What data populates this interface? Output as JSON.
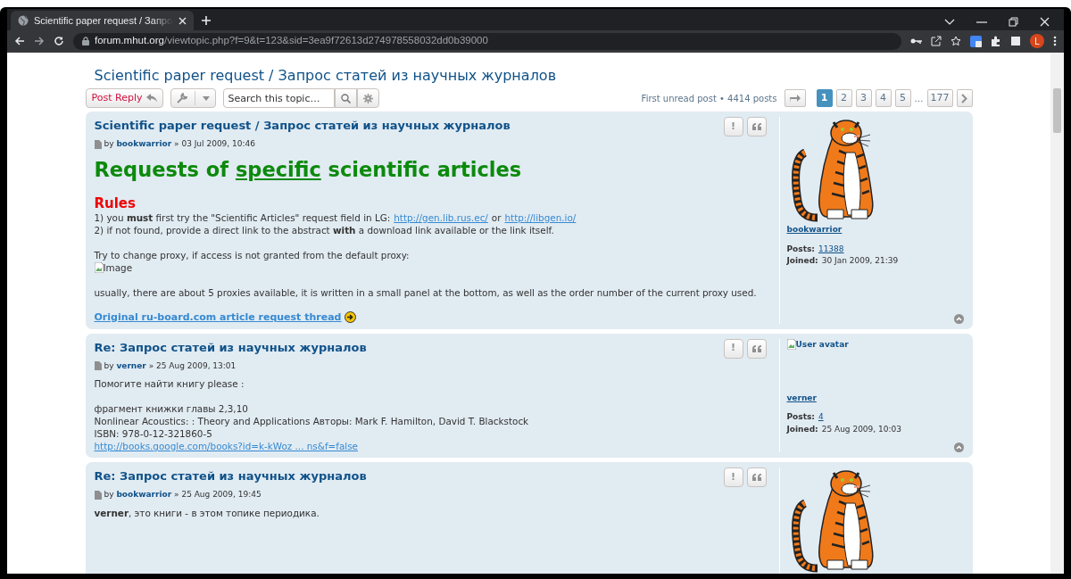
{
  "browser": {
    "tab": {
      "title": "Scientific paper request / Запро",
      "selected": true
    },
    "url": {
      "host": "forum.mhut.org",
      "path": "/viewtopic.php?f=9&t=123&sid=3ea9f72613d274978558032dd0b39000"
    },
    "profile_initial": "L"
  },
  "topic": {
    "title": "Scientific paper request / Запрос статей из научных журналов",
    "post_reply": "Post Reply",
    "search": {
      "placeholder": "Search this topic…"
    },
    "pagination": {
      "summary": "First unread post • 4414 posts",
      "pages": [
        {
          "label": "1",
          "selected": true
        },
        {
          "label": "2",
          "selected": false
        },
        {
          "label": "3",
          "selected": false
        },
        {
          "label": "4",
          "selected": false
        },
        {
          "label": "5",
          "selected": false
        },
        {
          "label": "…",
          "kind": "ellipsis"
        },
        {
          "label": "177",
          "selected": false
        }
      ]
    }
  },
  "posts": [
    {
      "title": "Scientific paper request / Запрос статей из научных журналов",
      "by": "by",
      "author": "bookwarrior",
      "date": "» 03 Jul 2009, 10:46",
      "body": [
        {
          "blocks": [
            {
              "kind": "heading",
              "parts": [
                {
                  "text": "Requests of ",
                  "underline": false
                },
                {
                  "text": "specific",
                  "underline": true
                },
                {
                  "text": " scientific articles",
                  "underline": false
                }
              ]
            }
          ]
        },
        {
          "blocks": [
            {
              "kind": "subheading",
              "text": "Rules"
            },
            {
              "kind": "line",
              "parts": [
                {
                  "text": "1) you **must** first try the \"Scientific Articles\" request field in LG:",
                  "link": false
                },
                {
                  "text": "http://gen.lib.rus.ec/",
                  "link": true
                },
                {
                  "text": "or",
                  "link": false
                },
                {
                  "text": "http://libgen.io/",
                  "link": true
                }
              ]
            },
            {
              "kind": "line",
              "parts": [
                {
                  "text": "2) if not found, provide a direct link to the abstract **with** a download link available or the link itself.",
                  "link": false
                }
              ]
            }
          ]
        },
        {
          "blocks": [
            {
              "kind": "line",
              "parts": [
                {
                  "text": "Try to change proxy, if access is not granted from the default proxy:",
                  "link": false
                }
              ]
            },
            {
              "kind": "broken-image",
              "alt": "Image"
            }
          ]
        },
        {
          "blocks": [
            {
              "kind": "line",
              "parts": [
                {
                  "text": "usually, there are about 5 proxies available, it is written in a small panel at the bottom, as well as the order number of the current proxy used.",
                  "link": false
                }
              ]
            }
          ]
        },
        {
          "blocks": [
            {
              "kind": "arrow-link",
              "text": "Original ru-board.com article request thread"
            }
          ]
        }
      ],
      "report_label": "!",
      "profile": {
        "avatar": {
          "kind": "tiger"
        },
        "username": "bookwarrior",
        "posts_label": "Posts:",
        "posts": "11388",
        "joined_label": "Joined:",
        "joined": "30 Jan 2009, 21:39"
      }
    },
    {
      "title": "Re: Запрос статей из научных журналов",
      "by": "by",
      "author": "verner",
      "date": "» 25 Aug 2009, 13:01",
      "body": [
        {
          "blocks": [
            {
              "kind": "line",
              "parts": [
                {
                  "text": "Помогите найти книгу please :",
                  "link": false
                }
              ]
            }
          ]
        },
        {
          "blocks": [
            {
              "kind": "line",
              "parts": [
                {
                  "text": "фрагмент книжки главы 2,3,10",
                  "link": false
                }
              ]
            },
            {
              "kind": "line",
              "parts": [
                {
                  "text": "Nonlinear Acoustics: : Theory and Applications Авторы: Mark F. Hamilton, David T. Blackstock",
                  "link": false
                }
              ]
            },
            {
              "kind": "line",
              "parts": [
                {
                  "text": "ISBN: 978-0-12-321860-5",
                  "link": false
                }
              ]
            },
            {
              "kind": "line",
              "parts": [
                {
                  "text": "http://books.google.com/books?id=k-kWoz ... ns&f=false",
                  "link": true
                }
              ]
            }
          ]
        }
      ],
      "report_label": "!",
      "profile": {
        "avatar": {
          "kind": "broken",
          "alt": "User avatar"
        },
        "username": "verner",
        "posts_label": "Posts:",
        "posts": "4",
        "joined_label": "Joined:",
        "joined": "25 Aug 2009, 10:03"
      }
    },
    {
      "title": "Re: Запрос статей из научных журналов",
      "by": "by",
      "author": "bookwarrior",
      "date": "» 25 Aug 2009, 19:45",
      "body": [
        {
          "blocks": [
            {
              "kind": "line",
              "parts": [
                {
                  "text": "**verner**, это книги - в этом топике периодика.",
                  "link": false
                }
              ]
            }
          ]
        }
      ],
      "report_label": "!",
      "profile": {
        "avatar": {
          "kind": "tiger"
        }
      }
    }
  ]
}
